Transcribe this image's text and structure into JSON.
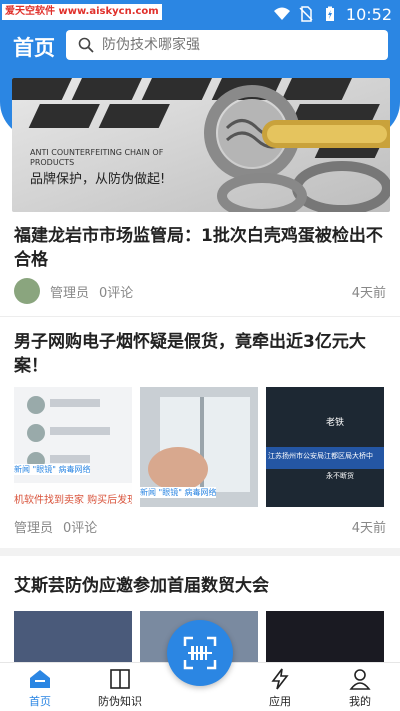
{
  "status_bar": {
    "watermark": "爱天空软件 www.aiskycn.com",
    "time": "10:52"
  },
  "header": {
    "title": "首页",
    "search_placeholder": "防伪技术哪家强"
  },
  "banner": {
    "text_en": "ANTI COUNTERFEITING CHAIN OF PRODUCTS",
    "text_cn": "品牌保护，从防伪做起!"
  },
  "articles": [
    {
      "title": "福建龙岩市市场监管局：1批次白壳鸡蛋被检出不合格",
      "author": "管理员",
      "comments": "0评论",
      "time": "4天前"
    },
    {
      "title": "男子网购电子烟怀疑是假货，竟牵出近3亿元大案！",
      "author": "管理员",
      "comments": "0评论",
      "time": "4天前",
      "thumb1_caption": "机软件找到卖家 购买后发现",
      "thumb1_tag": "新闻 \"眼镜\" 病毒网络",
      "thumb2_tag": "新闻 \"眼镜\" 病毒网络",
      "thumb3_text1": "老铁",
      "thumb3_text2": "江苏扬州市公安局江都区局大桥中",
      "thumb3_text3": "永不断货"
    },
    {
      "title": "艾斯芸防伪应邀参加首届数贸大会"
    }
  ],
  "tabbar": {
    "home": "首页",
    "knowledge": "防伪知识",
    "apps": "应用",
    "mine": "我的"
  },
  "colors": {
    "primary": "#2b86e3"
  }
}
